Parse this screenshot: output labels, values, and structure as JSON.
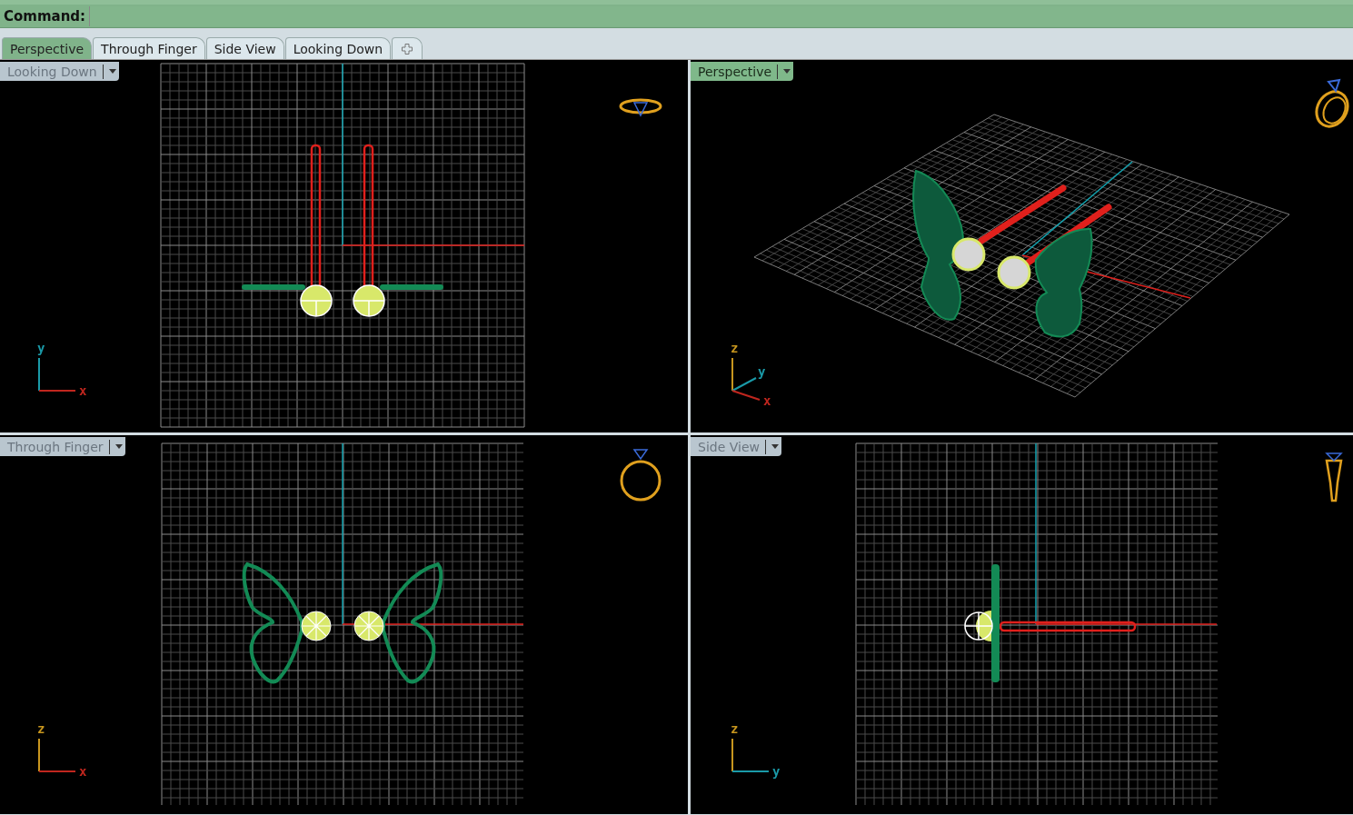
{
  "command": {
    "label": "Command:"
  },
  "tabs": [
    {
      "label": "Perspective",
      "selected": true
    },
    {
      "label": "Through Finger",
      "selected": false
    },
    {
      "label": "Side View",
      "selected": false
    },
    {
      "label": "Looking Down",
      "selected": false
    }
  ],
  "viewports": [
    {
      "title": "Looking Down",
      "selected": false,
      "kind": "top",
      "axes": [
        {
          "label": "y",
          "kind": "up",
          "color": "#1a9aa8"
        },
        {
          "label": "x",
          "kind": "right",
          "color": "#c0261e"
        }
      ]
    },
    {
      "title": "Perspective",
      "selected": true,
      "kind": "perspective",
      "axes": [
        {
          "label": "z",
          "kind": "up",
          "color": "#c8961e"
        },
        {
          "label": "y",
          "kind": "diagonal-up",
          "color": "#1a9aa8"
        },
        {
          "label": "x",
          "kind": "diagonal-down",
          "color": "#c0261e"
        }
      ]
    },
    {
      "title": "Through Finger",
      "selected": false,
      "kind": "front",
      "axes": [
        {
          "label": "z",
          "kind": "up",
          "color": "#c8961e"
        },
        {
          "label": "x",
          "kind": "right",
          "color": "#c0261e"
        }
      ]
    },
    {
      "title": "Side View",
      "selected": false,
      "kind": "side",
      "axes": [
        {
          "label": "z",
          "kind": "up",
          "color": "#c8961e"
        },
        {
          "label": "y",
          "kind": "right",
          "color": "#1a9aa8"
        }
      ]
    }
  ]
}
